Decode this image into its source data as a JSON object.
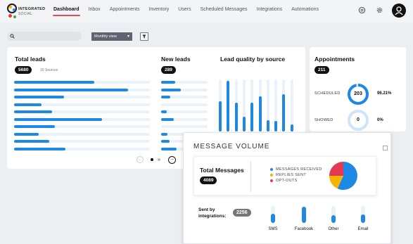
{
  "brand": {
    "name_line1": "INTEGRATED",
    "name_line2": "SOCIAL"
  },
  "nav": {
    "items": [
      "Dashboard",
      "Inbox",
      "Appointments",
      "Inventory",
      "Users",
      "Scheduled Messages",
      "Integrations",
      "Automations"
    ],
    "active": "Dashboard"
  },
  "toolbar": {
    "search_placeholder": "",
    "view_select": "Monthly view"
  },
  "total_leads": {
    "title": "Total leads",
    "count": "5680",
    "sources": "10 Sources",
    "bars": [
      0.59,
      0.84,
      0.37,
      0.2,
      0.28,
      0.65,
      0.3,
      0.18,
      0.26,
      0.38
    ]
  },
  "new_leads": {
    "title": "New leads",
    "count": "289",
    "bars": [
      0.3,
      0.42,
      0.2,
      0.0,
      0.12,
      0.28,
      0.0,
      0.14,
      0.18,
      0.34
    ]
  },
  "lead_quality": {
    "title": "Lead quality by source",
    "bars": [
      0.58,
      0.97,
      0.55,
      0.28,
      0.56,
      0.67,
      0.22,
      0.2,
      0.72,
      0.14
    ]
  },
  "pager": {
    "prev": "←",
    "next": "→"
  },
  "appointments": {
    "title": "Appointments",
    "count": "211",
    "scheduled_label": "SCHEDULED",
    "scheduled_value": "203",
    "scheduled_pct": "96.21%",
    "showed_label": "SHOWED",
    "showed_value": "0",
    "showed_pct": "0%"
  },
  "message_volume": {
    "title": "MESSAGE VOLUME",
    "total_label": "Total Messages",
    "total_count": "4089",
    "legend": [
      {
        "label": "MESSAGES RECEIVED",
        "color": "#1e88e5"
      },
      {
        "label": "REPLIES SENT",
        "color": "#f4b400"
      },
      {
        "label": "OPT-OUTS",
        "color": "#e53950"
      }
    ],
    "sent_by_label": "Sent by integrations:",
    "sent_by_count": "2256",
    "integrations": [
      {
        "label": "SMS",
        "level": 0.55
      },
      {
        "label": "Facebook",
        "level": 0.95
      },
      {
        "label": "Other",
        "level": 0.45
      },
      {
        "label": "Email",
        "level": 0.5
      }
    ]
  },
  "colors": {
    "accent": "#1e88e5",
    "active_nav": "#e24a5a",
    "track": "#eaf1f8"
  }
}
